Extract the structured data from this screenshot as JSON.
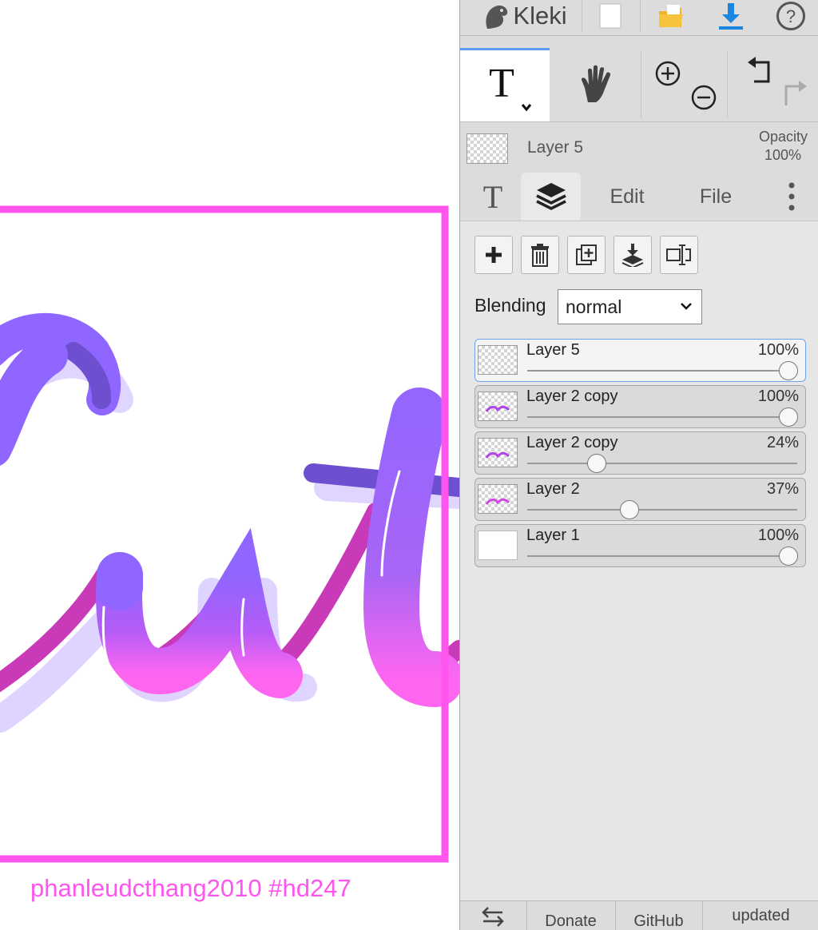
{
  "canvas": {
    "caption": "phanleudcthang2010 #hd247",
    "frame_color": "#ff55ee",
    "stroke_purple": "#8f66ff",
    "stroke_pink": "#ff66f0",
    "stroke_magenta": "#c83ab8"
  },
  "topbar": {
    "logo_text": "Kleki",
    "icons": [
      "kleki-logo-icon",
      "new-file-icon",
      "open-folder-icon",
      "download-icon",
      "help-icon"
    ]
  },
  "tools": {
    "active_tool": "text-tool",
    "items": [
      "text-tool-icon",
      "hand-icon",
      "zoom-in-icon",
      "zoom-out-icon",
      "undo-icon",
      "redo-icon"
    ]
  },
  "layer_info": {
    "name": "Layer 5",
    "opacity_label": "Opacity",
    "opacity_value": "100%"
  },
  "tabs": {
    "edit": "Edit",
    "file": "File",
    "active": "layers"
  },
  "layer_actions": [
    "add-layer-icon",
    "delete-layer-icon",
    "duplicate-layer-icon",
    "merge-down-icon",
    "rename-layer-icon"
  ],
  "blending": {
    "label": "Blending",
    "value": "normal"
  },
  "layers": [
    {
      "name": "Layer 5",
      "opacity": "100%",
      "opacity_value": 1.0,
      "selected": true
    },
    {
      "name": "Layer 2 copy",
      "opacity": "100%",
      "opacity_value": 1.0,
      "selected": false
    },
    {
      "name": "Layer 2 copy",
      "opacity": "24%",
      "opacity_value": 0.24,
      "selected": false
    },
    {
      "name": "Layer 2",
      "opacity": "37%",
      "opacity_value": 0.37,
      "selected": false
    },
    {
      "name": "Layer 1",
      "opacity": "100%",
      "opacity_value": 1.0,
      "selected": false
    }
  ],
  "footer": {
    "donate": "Donate",
    "github": "GitHub",
    "updated": "updated"
  }
}
